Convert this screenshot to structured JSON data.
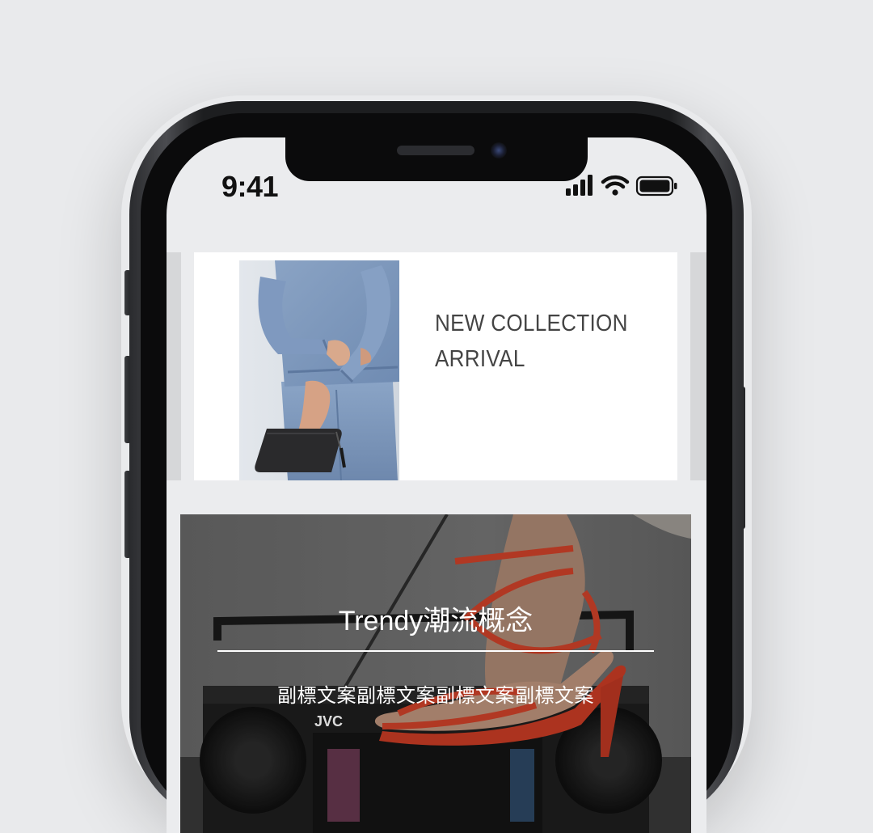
{
  "status_bar": {
    "time": "9:41",
    "icons": [
      "cellular-signal-icon",
      "wifi-icon",
      "battery-icon"
    ]
  },
  "banner": {
    "title_line1": "NEW COLLECTION",
    "title_line2": "ARRIVAL"
  },
  "feature": {
    "title": "Trendy潮流概念",
    "subtitle": "副標文案副標文案副標文案副標文案",
    "boombox_brand": "JVC"
  },
  "colors": {
    "page_background": "#e9eaec",
    "screen_background": "#ebecee",
    "card_background": "#ffffff",
    "banner_text": "#444444",
    "feature_overlay_text": "#ffffff",
    "sandal_accent": "#d8452b",
    "denim": "#7d97bb"
  }
}
